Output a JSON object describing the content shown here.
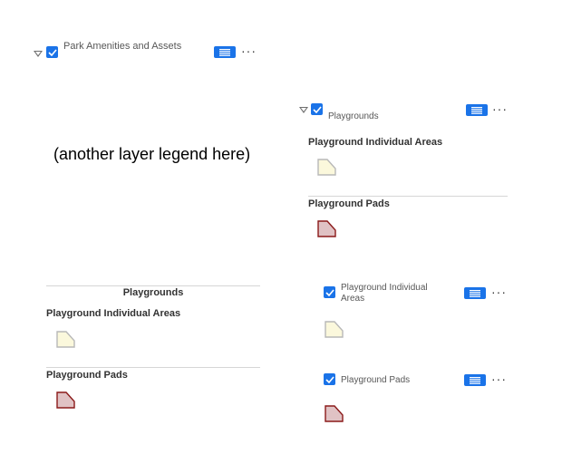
{
  "left": {
    "group": {
      "label": "Park Amenities and Assets"
    },
    "placeholder": "(another layer legend here)",
    "legend": {
      "title": "Playgrounds",
      "sections": [
        {
          "label": "Playground Individual Areas"
        },
        {
          "label": "Playground Pads"
        }
      ]
    }
  },
  "right": {
    "group": {
      "label": "Playgrounds",
      "sections": [
        {
          "label": "Playground Individual Areas"
        },
        {
          "label": "Playground Pads"
        }
      ]
    },
    "layers": [
      {
        "label_line1": "Playground Individual",
        "label_line2": "Areas"
      },
      {
        "label": "Playground Pads"
      }
    ]
  },
  "colors": {
    "accent": "#1a73e8",
    "individual_area_fill": "#fbf8dc",
    "individual_area_stroke": "#b8b8b8",
    "pad_fill": "#e0c2c4",
    "pad_stroke": "#8b1a1a"
  },
  "icons": {
    "caret": "caret-down-icon",
    "checkbox": "checkbox-checked-icon",
    "legend_button": "legend-list-icon",
    "more": "more-horizontal-icon",
    "swatch": "polygon-swatch-icon"
  }
}
